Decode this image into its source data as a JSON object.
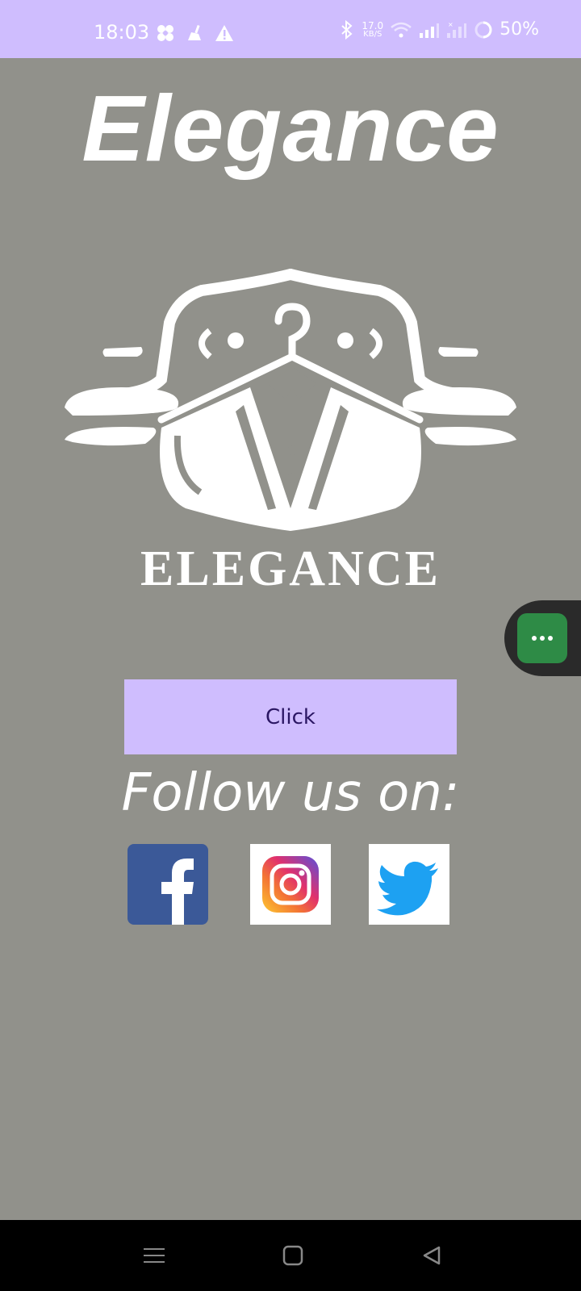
{
  "status_bar": {
    "time": "18:03",
    "net_speed_value": "17.0",
    "net_speed_unit": "KB/S",
    "battery": "50%"
  },
  "app": {
    "title": "Elegance",
    "logo_text": "ELEGANCE",
    "button_label": "Click",
    "follow_text": "Follow us on:"
  },
  "social": [
    "facebook-icon",
    "instagram-icon",
    "twitter-icon"
  ],
  "colors": {
    "background": "#91918b",
    "accent": "#cfbdfe",
    "button_text": "#2a1663",
    "facebook": "#3b5998",
    "twitter": "#1da1f2",
    "assistant": "#2e8b46"
  }
}
